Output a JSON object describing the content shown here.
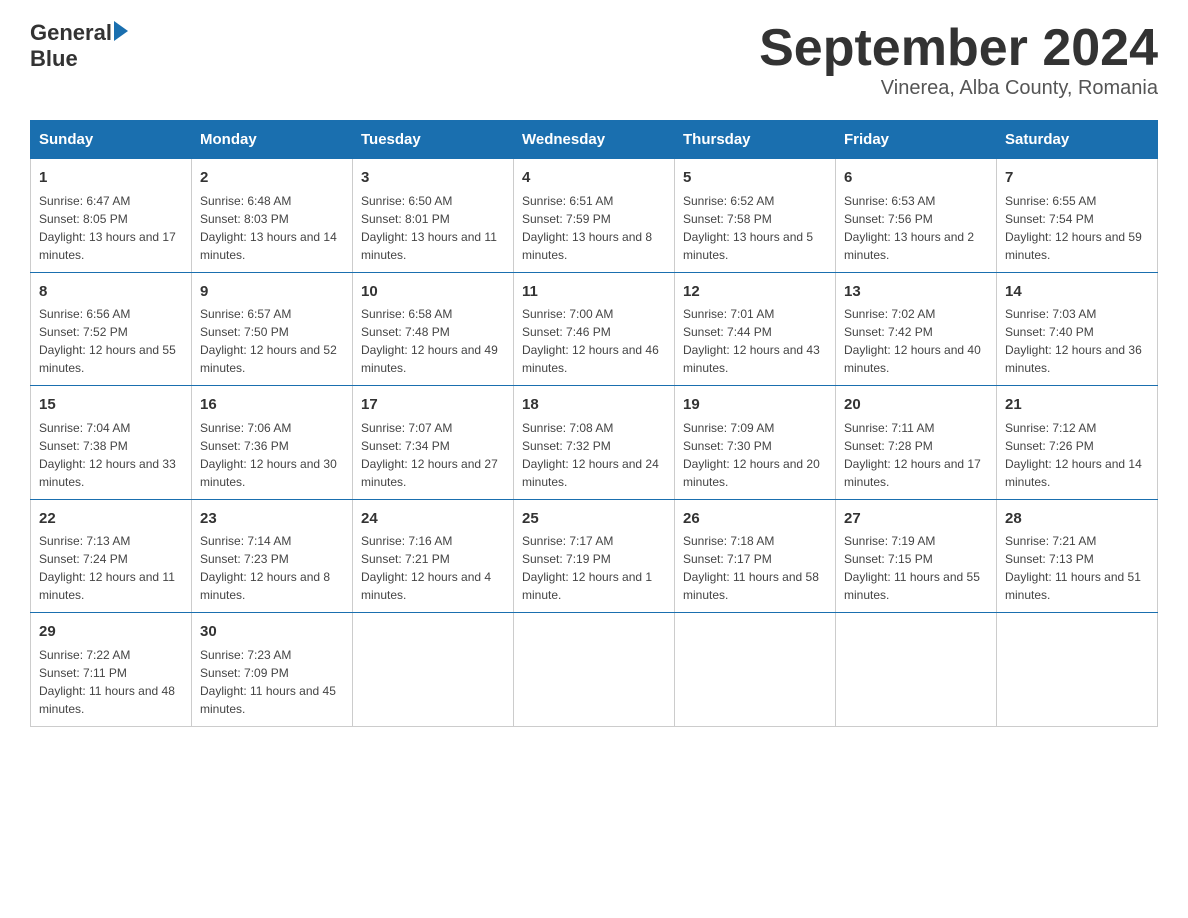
{
  "header": {
    "logo_line1": "General",
    "logo_line2": "Blue",
    "title": "September 2024",
    "subtitle": "Vinerea, Alba County, Romania"
  },
  "days_of_week": [
    "Sunday",
    "Monday",
    "Tuesday",
    "Wednesday",
    "Thursday",
    "Friday",
    "Saturday"
  ],
  "weeks": [
    [
      {
        "day": "1",
        "sunrise": "6:47 AM",
        "sunset": "8:05 PM",
        "daylight": "13 hours and 17 minutes."
      },
      {
        "day": "2",
        "sunrise": "6:48 AM",
        "sunset": "8:03 PM",
        "daylight": "13 hours and 14 minutes."
      },
      {
        "day": "3",
        "sunrise": "6:50 AM",
        "sunset": "8:01 PM",
        "daylight": "13 hours and 11 minutes."
      },
      {
        "day": "4",
        "sunrise": "6:51 AM",
        "sunset": "7:59 PM",
        "daylight": "13 hours and 8 minutes."
      },
      {
        "day": "5",
        "sunrise": "6:52 AM",
        "sunset": "7:58 PM",
        "daylight": "13 hours and 5 minutes."
      },
      {
        "day": "6",
        "sunrise": "6:53 AM",
        "sunset": "7:56 PM",
        "daylight": "13 hours and 2 minutes."
      },
      {
        "day": "7",
        "sunrise": "6:55 AM",
        "sunset": "7:54 PM",
        "daylight": "12 hours and 59 minutes."
      }
    ],
    [
      {
        "day": "8",
        "sunrise": "6:56 AM",
        "sunset": "7:52 PM",
        "daylight": "12 hours and 55 minutes."
      },
      {
        "day": "9",
        "sunrise": "6:57 AM",
        "sunset": "7:50 PM",
        "daylight": "12 hours and 52 minutes."
      },
      {
        "day": "10",
        "sunrise": "6:58 AM",
        "sunset": "7:48 PM",
        "daylight": "12 hours and 49 minutes."
      },
      {
        "day": "11",
        "sunrise": "7:00 AM",
        "sunset": "7:46 PM",
        "daylight": "12 hours and 46 minutes."
      },
      {
        "day": "12",
        "sunrise": "7:01 AM",
        "sunset": "7:44 PM",
        "daylight": "12 hours and 43 minutes."
      },
      {
        "day": "13",
        "sunrise": "7:02 AM",
        "sunset": "7:42 PM",
        "daylight": "12 hours and 40 minutes."
      },
      {
        "day": "14",
        "sunrise": "7:03 AM",
        "sunset": "7:40 PM",
        "daylight": "12 hours and 36 minutes."
      }
    ],
    [
      {
        "day": "15",
        "sunrise": "7:04 AM",
        "sunset": "7:38 PM",
        "daylight": "12 hours and 33 minutes."
      },
      {
        "day": "16",
        "sunrise": "7:06 AM",
        "sunset": "7:36 PM",
        "daylight": "12 hours and 30 minutes."
      },
      {
        "day": "17",
        "sunrise": "7:07 AM",
        "sunset": "7:34 PM",
        "daylight": "12 hours and 27 minutes."
      },
      {
        "day": "18",
        "sunrise": "7:08 AM",
        "sunset": "7:32 PM",
        "daylight": "12 hours and 24 minutes."
      },
      {
        "day": "19",
        "sunrise": "7:09 AM",
        "sunset": "7:30 PM",
        "daylight": "12 hours and 20 minutes."
      },
      {
        "day": "20",
        "sunrise": "7:11 AM",
        "sunset": "7:28 PM",
        "daylight": "12 hours and 17 minutes."
      },
      {
        "day": "21",
        "sunrise": "7:12 AM",
        "sunset": "7:26 PM",
        "daylight": "12 hours and 14 minutes."
      }
    ],
    [
      {
        "day": "22",
        "sunrise": "7:13 AM",
        "sunset": "7:24 PM",
        "daylight": "12 hours and 11 minutes."
      },
      {
        "day": "23",
        "sunrise": "7:14 AM",
        "sunset": "7:23 PM",
        "daylight": "12 hours and 8 minutes."
      },
      {
        "day": "24",
        "sunrise": "7:16 AM",
        "sunset": "7:21 PM",
        "daylight": "12 hours and 4 minutes."
      },
      {
        "day": "25",
        "sunrise": "7:17 AM",
        "sunset": "7:19 PM",
        "daylight": "12 hours and 1 minute."
      },
      {
        "day": "26",
        "sunrise": "7:18 AM",
        "sunset": "7:17 PM",
        "daylight": "11 hours and 58 minutes."
      },
      {
        "day": "27",
        "sunrise": "7:19 AM",
        "sunset": "7:15 PM",
        "daylight": "11 hours and 55 minutes."
      },
      {
        "day": "28",
        "sunrise": "7:21 AM",
        "sunset": "7:13 PM",
        "daylight": "11 hours and 51 minutes."
      }
    ],
    [
      {
        "day": "29",
        "sunrise": "7:22 AM",
        "sunset": "7:11 PM",
        "daylight": "11 hours and 48 minutes."
      },
      {
        "day": "30",
        "sunrise": "7:23 AM",
        "sunset": "7:09 PM",
        "daylight": "11 hours and 45 minutes."
      },
      null,
      null,
      null,
      null,
      null
    ]
  ]
}
